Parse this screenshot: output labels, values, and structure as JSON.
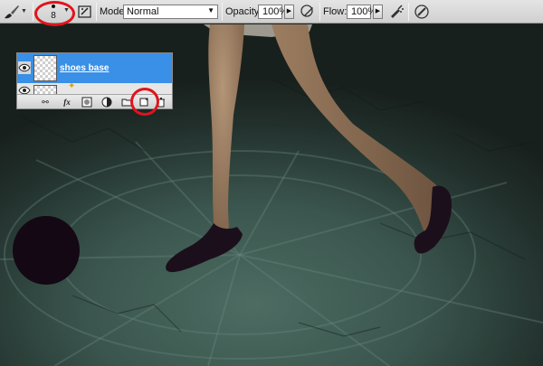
{
  "options_bar": {
    "brush_size": "8",
    "mode_label": "Mode:",
    "mode_value": "Normal",
    "opacity_label": "Opacity:",
    "opacity_value": "100%",
    "flow_label": "Flow:",
    "flow_value": "100%",
    "icons": [
      "brush-tool-icon",
      "brush-preset-picker-icon",
      "brush-palette-icon",
      "tablet-pressure-opacity-icon",
      "airbrush-icon",
      "tablet-pressure-size-icon"
    ]
  },
  "layers_panel": {
    "layers": [
      {
        "name": "shoes base",
        "selected": true
      }
    ],
    "footer_buttons": [
      "link-layers-icon",
      "fx-icon",
      "add-mask-icon",
      "adjustment-layer-icon",
      "new-group-icon",
      "new-layer-icon",
      "delete-layer-icon"
    ],
    "fx_label": "fx"
  },
  "annotations": {
    "color": "#e0141b",
    "highlighted": [
      "brush-size-picker",
      "new-layer-button"
    ]
  },
  "canvas": {
    "scene": "legs in black flats walking on stone floor with radiating lines",
    "shoe_color": "#1c0f1c",
    "floor_color": "#3f5b52"
  }
}
